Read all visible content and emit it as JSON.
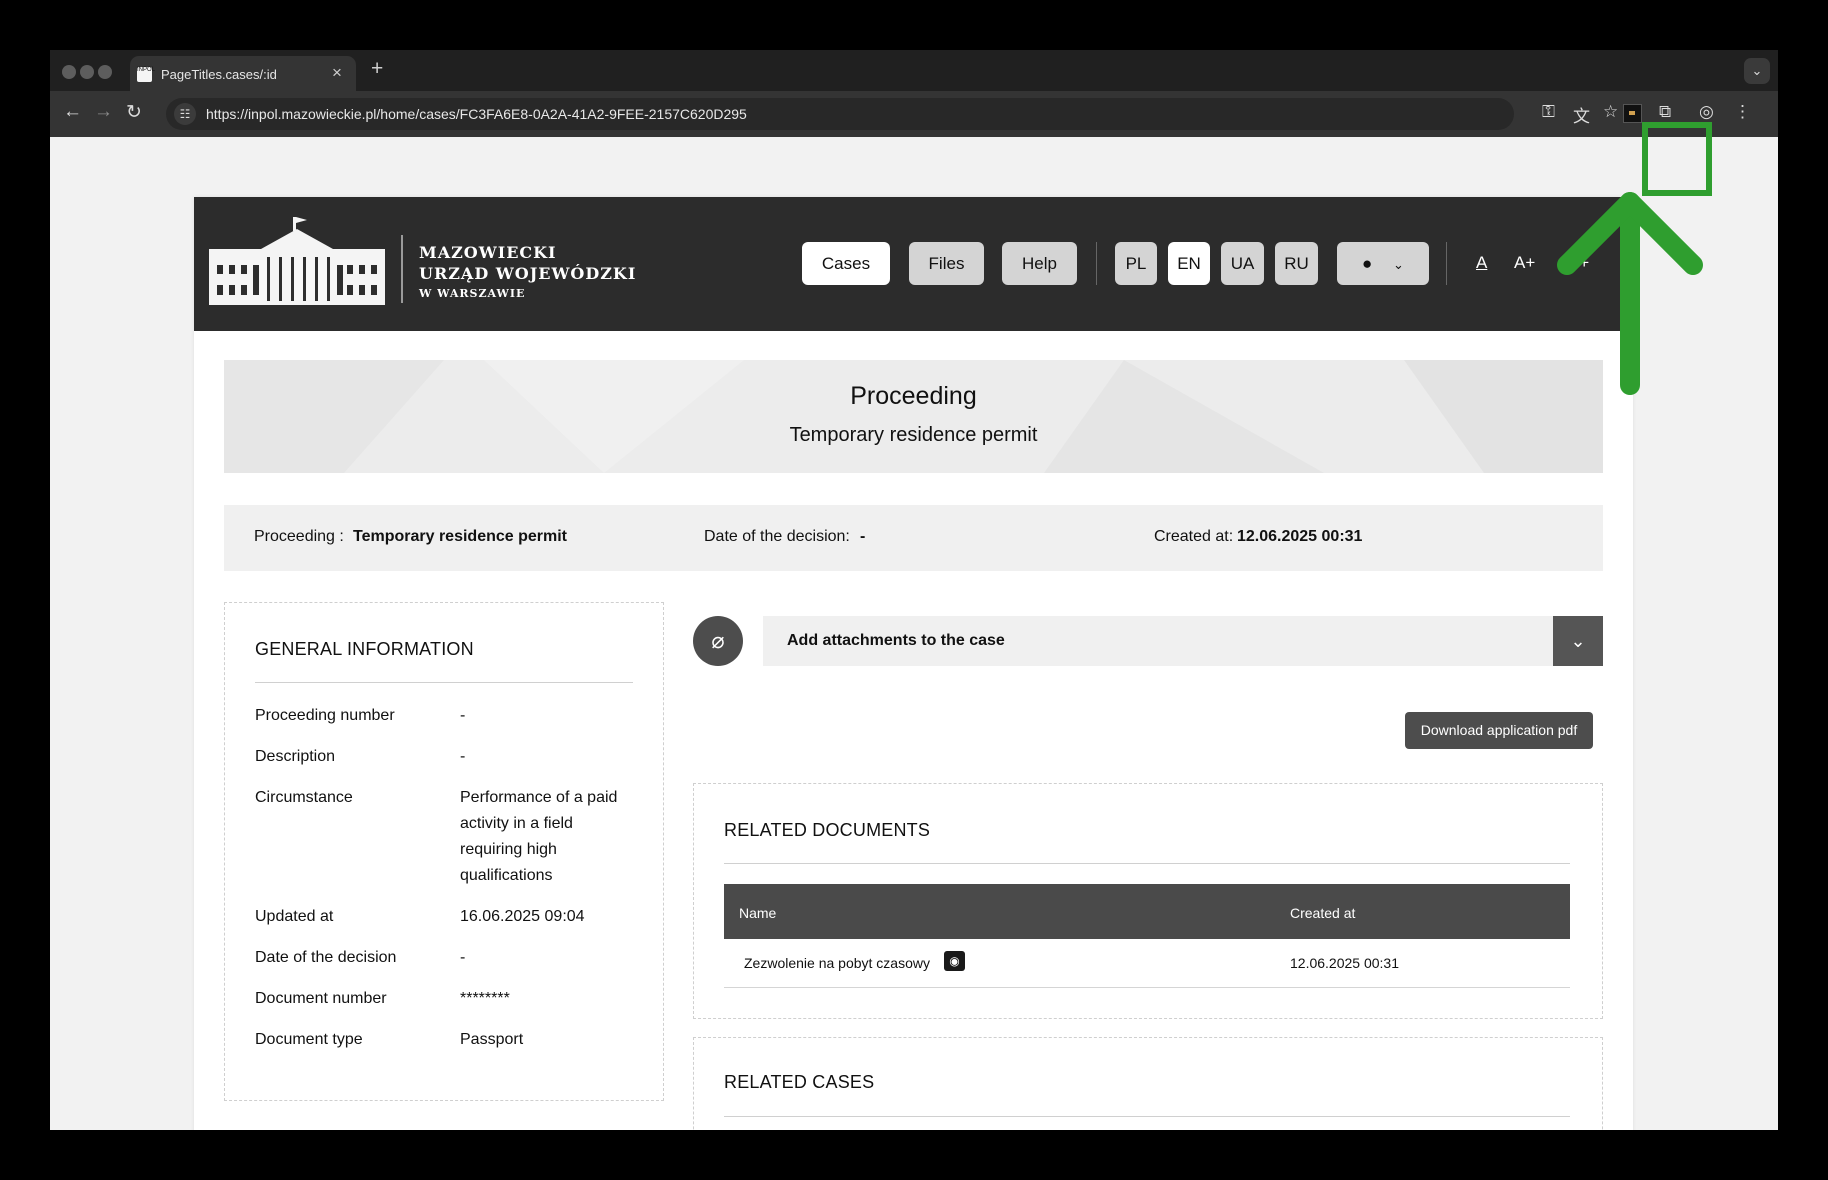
{
  "browser": {
    "tab_title": "PageTitles.cases/:id",
    "tab_favicon_text": "INPOL",
    "url": "https://inpol.mazowieckie.pl/home/cases/FC3FA6E8-0A2A-41A2-9FEE-2157C620D295"
  },
  "header": {
    "logo_line1": "MAZOWIECKI",
    "logo_line2": "URZĄD WOJEWÓDZKI",
    "logo_line3": "W WARSZAWIE",
    "nav": [
      "Cases",
      "Files",
      "Help"
    ],
    "languages": [
      "PL",
      "EN",
      "UA",
      "RU"
    ],
    "active_language": "EN",
    "font_sizes": [
      "A",
      "A+",
      "A++"
    ]
  },
  "banner": {
    "title": "Proceeding",
    "subtitle": "Temporary residence permit"
  },
  "info": {
    "proceeding_label": "Proceeding :",
    "proceeding_value": "Temporary residence permit",
    "decision_label": "Date of the decision:",
    "decision_value": "-",
    "created_label": "Created at:",
    "created_value": "12.06.2025 00:31"
  },
  "general": {
    "title": "GENERAL INFORMATION",
    "rows": [
      {
        "label": "Proceeding number",
        "value": "-"
      },
      {
        "label": "Description",
        "value": "-"
      },
      {
        "label": "Circumstance",
        "value": "Performance of a paid activity in a field requiring high qualifications"
      },
      {
        "label": "Updated at",
        "value": "16.06.2025 09:04"
      },
      {
        "label": "Date of the decision",
        "value": "-"
      },
      {
        "label": "Document number",
        "value": "********"
      },
      {
        "label": "Document type",
        "value": "Passport"
      }
    ]
  },
  "attachments": {
    "label": "Add attachments to the case"
  },
  "download_button": "Download application pdf",
  "related_documents": {
    "title": "RELATED DOCUMENTS",
    "columns": [
      "Name",
      "Created at"
    ],
    "rows": [
      {
        "name": "Zezwolenie na pobyt czasowy",
        "created": "12.06.2025 00:31"
      }
    ]
  },
  "related_cases": {
    "title": "RELATED CASES"
  },
  "colors": {
    "header_bg": "#2c2c2c",
    "highlight_green": "#2f9e2f"
  }
}
